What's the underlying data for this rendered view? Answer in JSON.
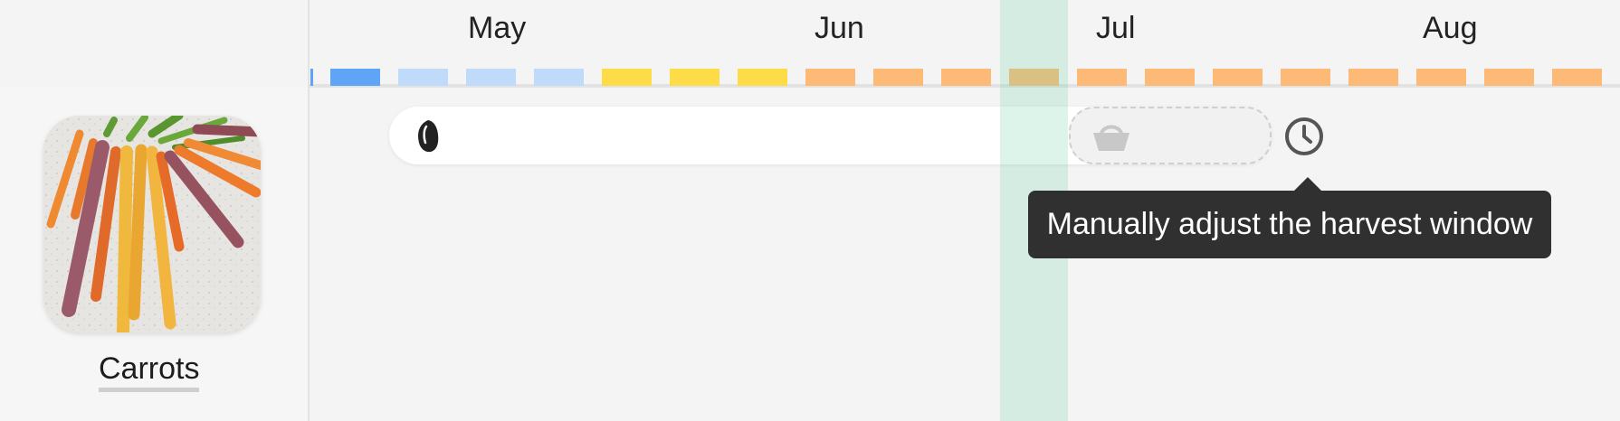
{
  "timeline": {
    "months": [
      {
        "label": "May"
      },
      {
        "label": "Jun"
      },
      {
        "label": "Jul"
      },
      {
        "label": "Aug"
      }
    ],
    "weeks": [
      "sow-indoor",
      "sow-indoor-light",
      "sow-indoor-light",
      "sow-indoor-light",
      "transplant",
      "transplant",
      "transplant",
      "harvest",
      "harvest",
      "harvest",
      "harvest",
      "harvest",
      "harvest",
      "harvest",
      "harvest",
      "harvest",
      "harvest",
      "harvest",
      "harvest"
    ]
  },
  "colors": {
    "sow-indoor": "#5ea5f6",
    "sow-indoor-light": "#c0dafa",
    "transplant": "#fddc47",
    "harvest": "#fdba76",
    "today": "#78d2aa",
    "tooltip_bg": "#303030"
  },
  "plant": {
    "name": "Carrots",
    "image_icon": "carrots-photo"
  },
  "bar": {
    "seed_icon": "seed-icon",
    "harvest_icon": "basket-icon",
    "clock_icon": "clock-icon"
  },
  "tooltip": {
    "text": "Manually adjust the harvest window"
  }
}
